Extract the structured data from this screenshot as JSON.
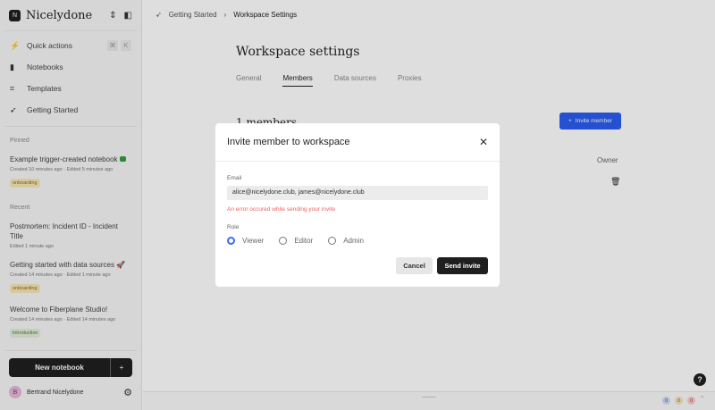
{
  "workspace": {
    "logo_letter": "N",
    "name": "Nicelydone"
  },
  "nav": [
    {
      "label": "Quick actions",
      "icon": "bolt-icon"
    },
    {
      "label": "Notebooks",
      "icon": "notebook-icon"
    },
    {
      "label": "Templates",
      "icon": "templates-icon"
    },
    {
      "label": "Getting Started",
      "icon": "rocket-icon"
    }
  ],
  "shortcut": [
    "⌘",
    "K"
  ],
  "pinned": {
    "heading": "Pinned",
    "items": [
      {
        "title": "Example trigger-created notebook",
        "meta": "Created 10 minutes ago · Edited 5 minutes ago",
        "tag": "onboarding"
      }
    ]
  },
  "recent": {
    "heading": "Recent",
    "items": [
      {
        "title": "Postmortem: Incident ID - Incident Title",
        "meta": "Edited 1 minute ago"
      },
      {
        "title": "Getting started with data sources 🚀",
        "meta": "Created 14 minutes ago · Edited 1 minute ago",
        "tag": "onboarding"
      },
      {
        "title": "Welcome to Fiberplane Studio!",
        "meta": "Created 14 minutes ago · Edited 14 minutes ago",
        "tag": "introduction"
      }
    ]
  },
  "new_notebook": "New notebook",
  "new_plus": "+",
  "user": {
    "initial": "B",
    "name": "Bertrand Nicelydone"
  },
  "breadcrumb": [
    "Getting Started",
    "Workspace Settings"
  ],
  "page_title": "Workspace settings",
  "tabs": [
    "General",
    "Members",
    "Data sources",
    "Proxies"
  ],
  "members_count": "1 members",
  "invite_button": "Invite member",
  "owner_label": "Owner",
  "help": "?",
  "counters": [
    "0",
    "0",
    "0"
  ],
  "modal": {
    "title": "Invite member to workspace",
    "email_label": "Email",
    "email_value": "alice@nicelydone.club, james@nicelydone.club",
    "error": "An error occured while sending your invite",
    "role_label": "Role",
    "roles": [
      "Viewer",
      "Editor",
      "Admin"
    ],
    "selected_role": "Viewer",
    "cancel": "Cancel",
    "send": "Send invite"
  }
}
